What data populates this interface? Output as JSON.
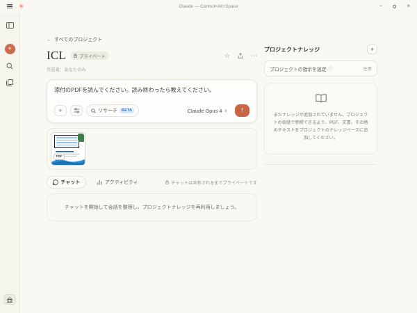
{
  "titlebar": {
    "title": "Claude — Control+Alt+Space"
  },
  "glyphs": {
    "back_arrow": "←",
    "plus": "+",
    "star": "☆",
    "ellipsis": "⋯",
    "chevron_down": "∨",
    "send_arrow": "↑",
    "minimize": "−",
    "close": "×",
    "info": "ⓘ"
  },
  "main": {
    "breadcrumb_label": "すべてのプロジェクト",
    "project": {
      "title": "ICL",
      "privacy_badge": "プライベート",
      "creator": "作成者：あなたのみ"
    },
    "composer": {
      "input_text": "添付のPDFを読んでください。読み終わったら教えてください。",
      "research_label": "リサーチ",
      "beta_label": "BETA",
      "model_label": "Claude Opus 4"
    },
    "attachment": {
      "type_label": "PDF"
    },
    "tabs": [
      {
        "label": "チャット"
      },
      {
        "label": "アクティビティ"
      }
    ],
    "privacy_note": "チャットは共有されるまでプライベートです",
    "empty_chats_text": "チャットを開始して会話を整理し、プロジェクトナレッジを再利用しましょう。"
  },
  "knowledge_panel": {
    "title": "プロジェクトナレッジ",
    "instructions_label": "プロジェクトの指示を設定",
    "optional_label": "任意",
    "empty_text": "まだナレッジが追加されていません。プロジェクトの会話で参照できるよう、PDF、文書、その他のテキストをプロジェクトのナレッジベースに追加してください。"
  },
  "colors": {
    "accent_orange": "#cb6a4b",
    "beta_blue": "#2c79c2",
    "background_cream": "#f9f8f2"
  }
}
